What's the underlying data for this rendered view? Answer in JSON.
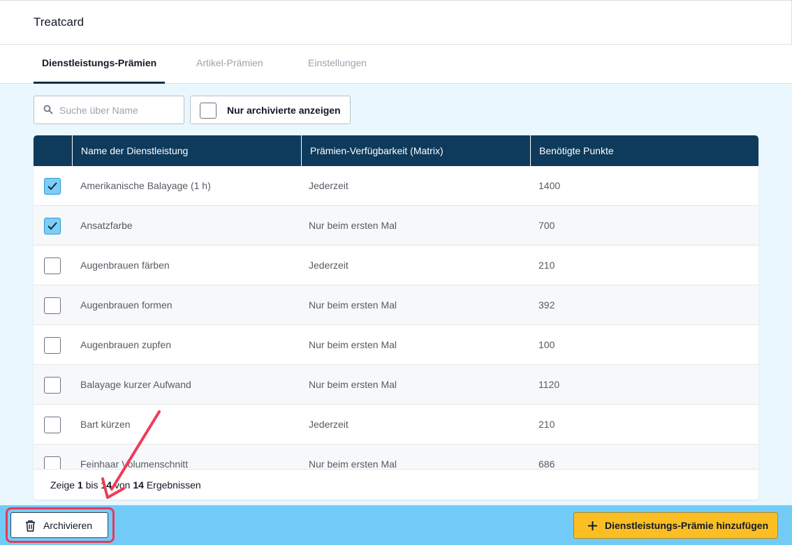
{
  "app": {
    "title": "Treatcard"
  },
  "tabs": [
    {
      "label": "Dienstleistungs-Prämien",
      "active": true
    },
    {
      "label": "Artikel-Prämien",
      "active": false
    },
    {
      "label": "Einstellungen",
      "active": false
    }
  ],
  "filters": {
    "search_placeholder": "Suche über Name",
    "search_value": "",
    "archived_toggle_label": "Nur archivierte anzeigen",
    "archived_checked": false
  },
  "table": {
    "columns": [
      "Name der Dienstleistung",
      "Prämien-Verfügbarkeit (Matrix)",
      "Benötigte Punkte"
    ],
    "rows": [
      {
        "checked": true,
        "name": "Amerikanische Balayage (1 h)",
        "availability": "Jederzeit",
        "points": "1400"
      },
      {
        "checked": true,
        "name": "Ansatzfarbe",
        "availability": "Nur beim ersten Mal",
        "points": "700"
      },
      {
        "checked": false,
        "name": "Augenbrauen färben",
        "availability": "Jederzeit",
        "points": "210"
      },
      {
        "checked": false,
        "name": "Augenbrauen formen",
        "availability": "Nur beim ersten Mal",
        "points": "392"
      },
      {
        "checked": false,
        "name": "Augenbrauen zupfen",
        "availability": "Nur beim ersten Mal",
        "points": "100"
      },
      {
        "checked": false,
        "name": "Balayage kurzer Aufwand",
        "availability": "Nur beim ersten Mal",
        "points": "1120"
      },
      {
        "checked": false,
        "name": "Bart kürzen",
        "availability": "Jederzeit",
        "points": "210"
      },
      {
        "checked": false,
        "name": "Feinhaar Volumenschnitt",
        "availability": "Nur beim ersten Mal",
        "points": "686"
      }
    ],
    "footer": {
      "prefix": "Zeige",
      "from": "1",
      "mid": "bis",
      "to": "14",
      "of": "von",
      "total": "14",
      "suffix": "Ergebnissen"
    }
  },
  "actions": {
    "archive_label": "Archivieren",
    "add_label": "Dienstleistungs-Prämie hinzufügen"
  },
  "colors": {
    "header_bg": "#0e3a5b",
    "content_bg": "#eaf7fe",
    "bottom_bar_bg": "#72cbf7",
    "primary_button": "#fbbf24",
    "checkbox_checked": "#7dcdf7",
    "highlight": "#e83a58"
  },
  "icons": {
    "search": "search-icon",
    "check": "check-icon",
    "trash": "trash-icon",
    "plus": "plus-icon",
    "annotation": "arrow-annotation"
  }
}
